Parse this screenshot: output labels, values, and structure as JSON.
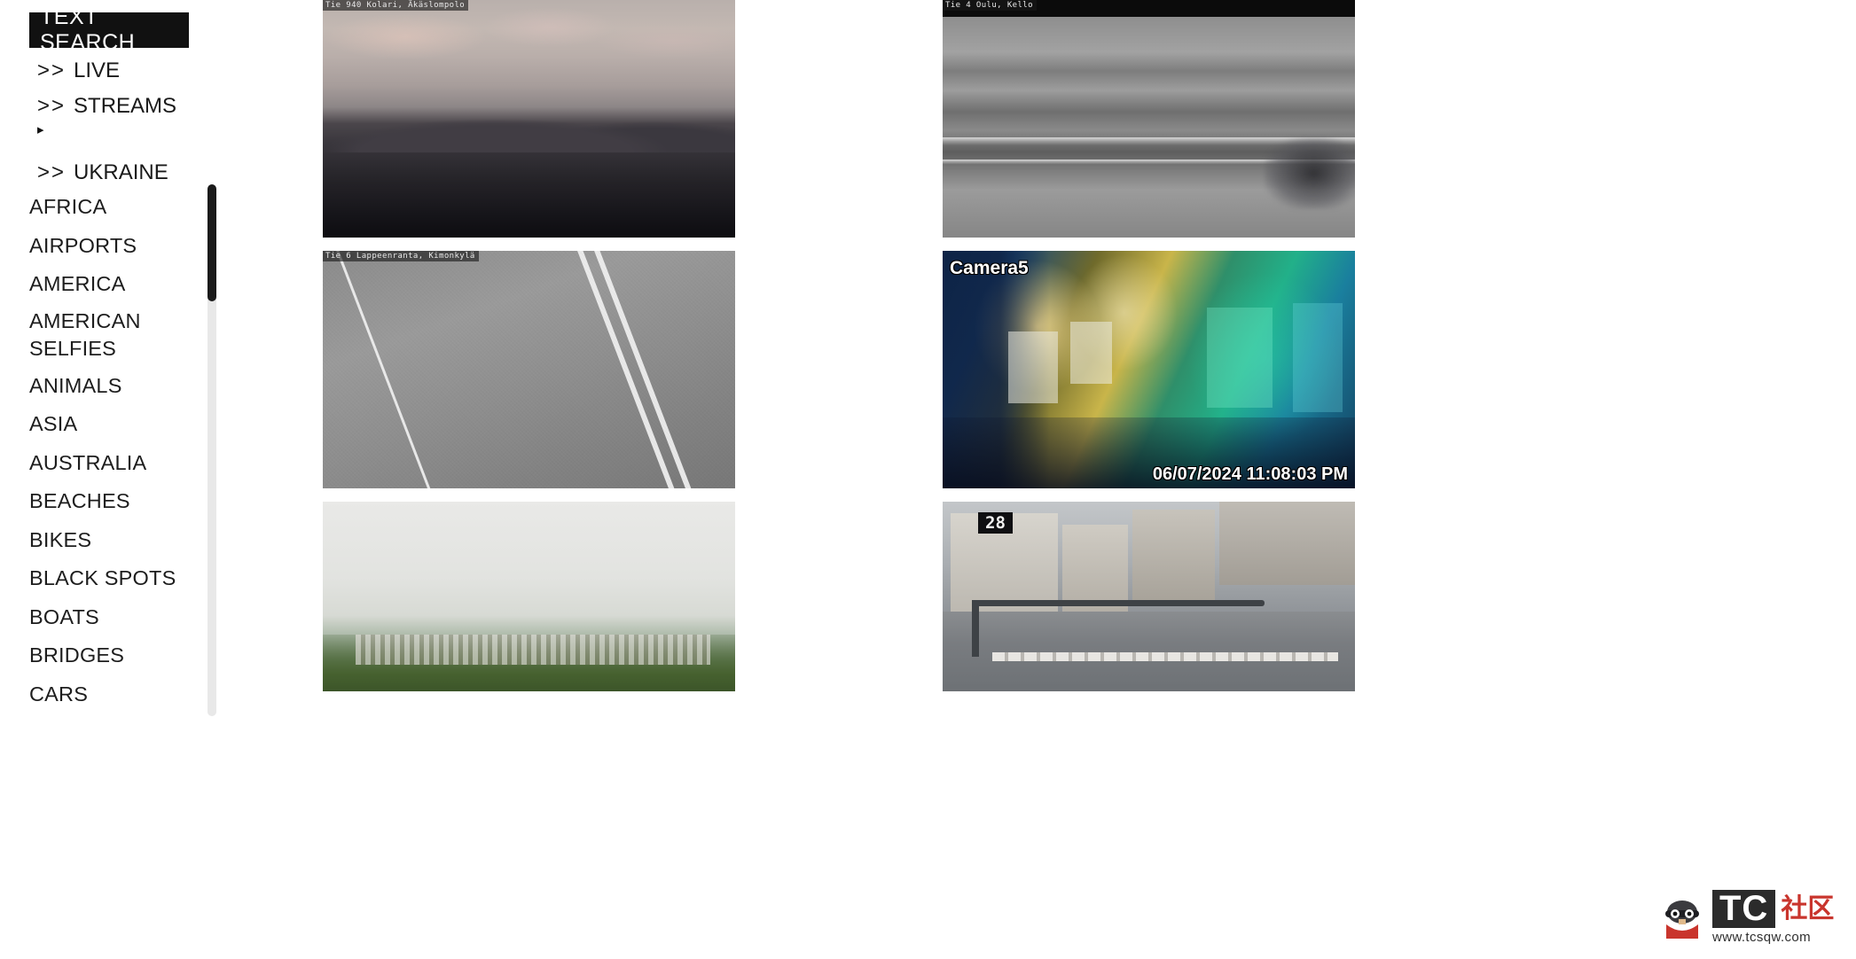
{
  "sidebar": {
    "search_header": "TEXT SEARCH",
    "nav_links": [
      {
        "chevron": ">>",
        "label": "LIVE"
      },
      {
        "chevron": ">>",
        "label": "STREAMS"
      },
      {
        "chevron": ">>",
        "label": "UKRAINE"
      }
    ],
    "caret_icon": "▸",
    "categories": [
      "AFRICA",
      "AIRPORTS",
      "AMERICA",
      "AMERICAN SELFIES",
      "ANIMALS",
      "ASIA",
      "AUSTRALIA",
      "BEACHES",
      "BIKES",
      "BLACK SPOTS",
      "BOATS",
      "BRIDGES",
      "CARS"
    ],
    "scrollbar": {
      "name": "vertical-scrollbar"
    }
  },
  "cameras": {
    "left": [
      {
        "caption": "Tie 940 Kolari, Äkäslompolo",
        "scene": "fell"
      },
      {
        "caption": "Tie 6 Lappeenranta, Kimonkylä",
        "scene": "asphalt"
      },
      {
        "caption": "",
        "scene": "fog"
      }
    ],
    "right": [
      {
        "caption": "Tie 4 Oulu, Kello",
        "scene": "highway"
      },
      {
        "overlay_label": "Camera5",
        "timestamp": "06/07/2024 11:08:03 PM",
        "scene": "store"
      },
      {
        "badge": "28",
        "scene": "city"
      }
    ]
  },
  "watermark": {
    "brand": "TC",
    "suffix": "社区",
    "url": "www.tcsqw.com"
  }
}
